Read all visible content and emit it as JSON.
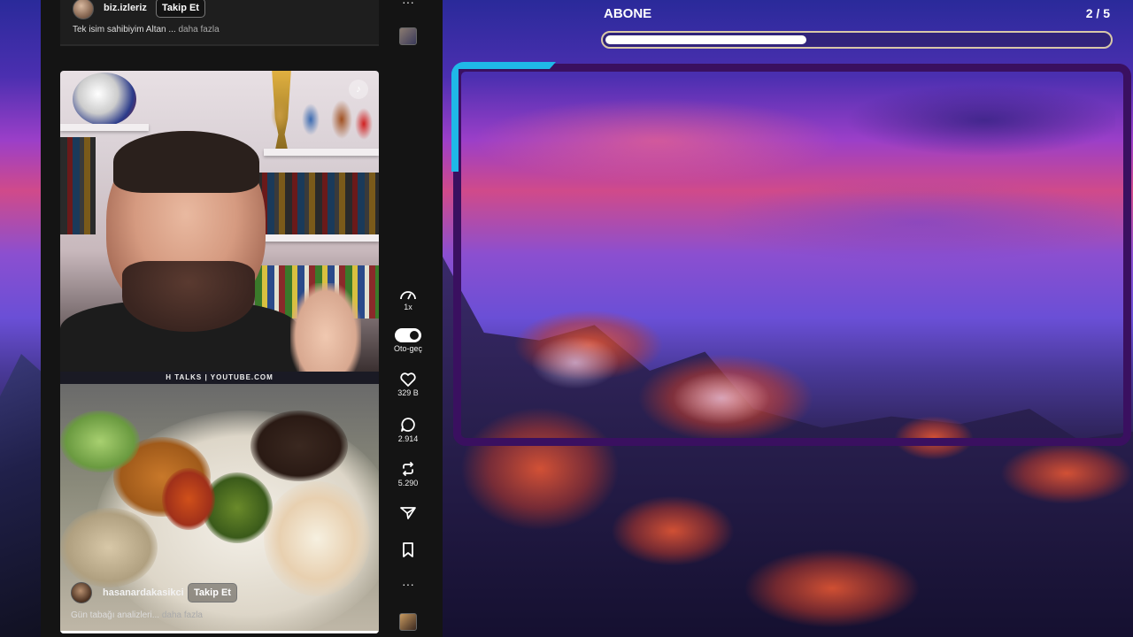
{
  "top_post": {
    "username": "biz.izleriz",
    "follow_label": "Takip Et",
    "caption": "Tek isim sahibiyim Altan ...",
    "more_label": "daha fazla"
  },
  "video_post": {
    "watermark": "H TALKS | YOUTUBE.COM",
    "username": "hasanardakasikci",
    "follow_label": "Takip Et",
    "caption": "Gün tabağı analizleri...",
    "more_label": "daha fazla"
  },
  "actions": {
    "speed_label": "1x",
    "autoplay_label": "Oto-geç",
    "likes": "329 B",
    "comments": "2.914",
    "reposts": "5.290",
    "more_symbol": "···"
  },
  "subscriber_goal": {
    "title": "ABONE",
    "count": "2 / 5",
    "progress": 0.4
  },
  "colors": {
    "frame": "#3a1060",
    "frame_accent": "#1fb8e8",
    "panel": "#141414"
  }
}
